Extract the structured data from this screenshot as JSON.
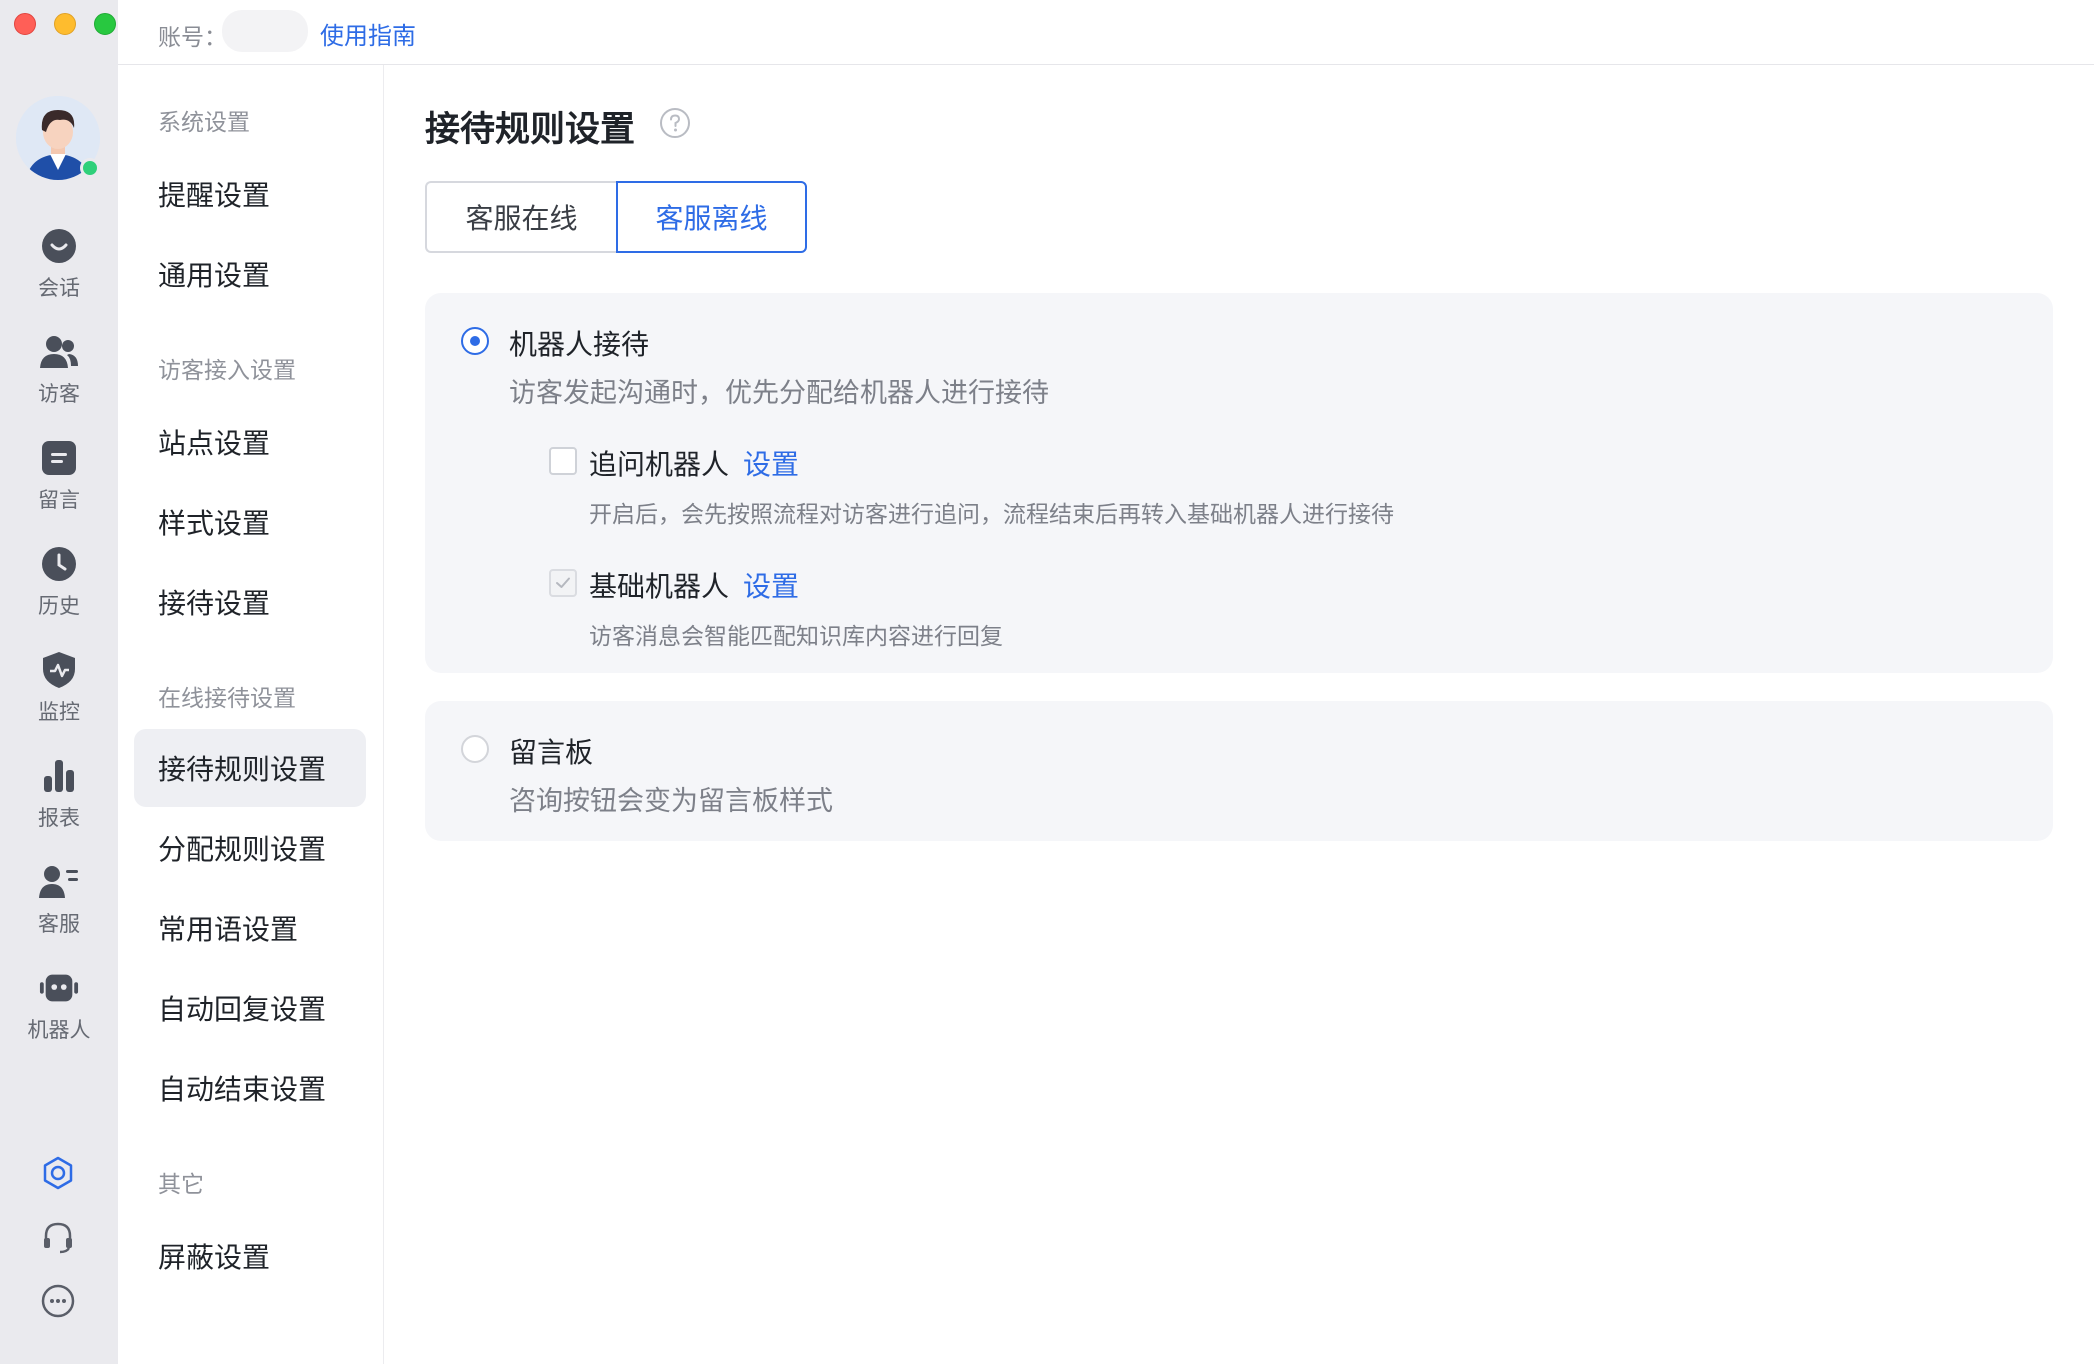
{
  "topbar": {
    "account_label": "账号：",
    "guide_link": "使用指南"
  },
  "rail": {
    "items": [
      {
        "label": "会话",
        "icon": "chat-bubble-icon"
      },
      {
        "label": "访客",
        "icon": "visitors-icon"
      },
      {
        "label": "留言",
        "icon": "message-note-icon"
      },
      {
        "label": "历史",
        "icon": "clock-icon"
      },
      {
        "label": "监控",
        "icon": "shield-monitor-icon"
      },
      {
        "label": "报表",
        "icon": "bar-chart-icon"
      },
      {
        "label": "客服",
        "icon": "agent-list-icon"
      },
      {
        "label": "机器人",
        "icon": "robot-icon"
      }
    ],
    "bottom_icons": [
      "settings-ring-icon",
      "headset-icon",
      "more-dots-icon"
    ],
    "status_color": "#2fd07a"
  },
  "nav": {
    "sections": [
      {
        "title": "系统设置",
        "items": [
          "提醒设置",
          "通用设置"
        ]
      },
      {
        "title": "访客接入设置",
        "items": [
          "站点设置",
          "样式设置",
          "接待设置"
        ]
      },
      {
        "title": "在线接待设置",
        "items": [
          "接待规则设置",
          "分配规则设置",
          "常用语设置",
          "自动回复设置",
          "自动结束设置"
        ]
      },
      {
        "title": "其它",
        "items": [
          "屏蔽设置"
        ]
      }
    ],
    "active_item": "接待规则设置"
  },
  "main": {
    "title": "接待规则设置",
    "help_icon": "question-circle-icon",
    "tabs": [
      {
        "label": "客服在线",
        "selected": false
      },
      {
        "label": "客服离线",
        "selected": true
      }
    ],
    "options": [
      {
        "title": "机器人接待",
        "description": "访客发起沟通时，优先分配给机器人进行接待",
        "selected": true,
        "sub_options": [
          {
            "title": "追问机器人",
            "link": "设置",
            "description": "开启后，会先按照流程对访客进行追问，流程结束后再转入基础机器人进行接待",
            "checked": false,
            "disabled": false
          },
          {
            "title": "基础机器人",
            "link": "设置",
            "description": "访客消息会智能匹配知识库内容进行回复",
            "checked": true,
            "disabled": true
          }
        ]
      },
      {
        "title": "留言板",
        "description": "咨询按钮会变为留言板样式",
        "selected": false
      }
    ]
  },
  "colors": {
    "accent": "#2e6ce6",
    "rail_bg": "#eaeaee",
    "card_bg": "#f5f6f9"
  }
}
